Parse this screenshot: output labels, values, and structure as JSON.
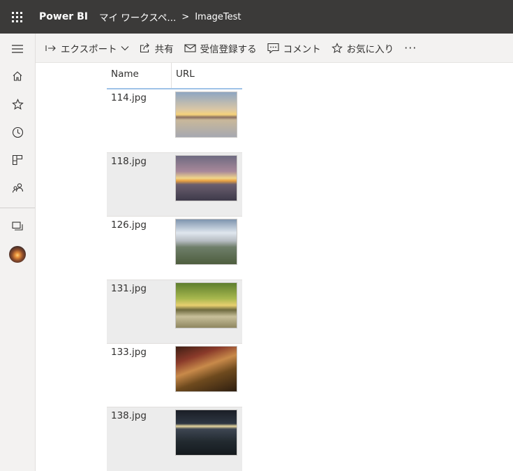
{
  "header": {
    "app_name": "Power BI",
    "workspace": "マイ ワークスペ...",
    "breadcrumb_separator": ">",
    "report": "ImageTest"
  },
  "leftrail": {
    "items": [
      "hamburger-icon",
      "home-icon",
      "star-icon",
      "clock-icon",
      "apps-icon",
      "people-icon",
      "workspaces-icon",
      "avatar"
    ]
  },
  "commandbar": {
    "export_label": "エクスポート",
    "share_label": "共有",
    "subscribe_label": "受信登録する",
    "comment_label": "コメント",
    "favorite_label": "お気に入り",
    "more_label": "···"
  },
  "table": {
    "columns": [
      "Name",
      "URL"
    ],
    "rows": [
      {
        "name": "114.jpg"
      },
      {
        "name": "118.jpg"
      },
      {
        "name": "126.jpg"
      },
      {
        "name": "131.jpg"
      },
      {
        "name": "133.jpg"
      },
      {
        "name": "138.jpg"
      }
    ]
  },
  "colors": {
    "topbar": "#3b3a39",
    "rail": "#f3f2f1",
    "header_underline": "#9fc3e7",
    "alt_row": "#ececec"
  }
}
